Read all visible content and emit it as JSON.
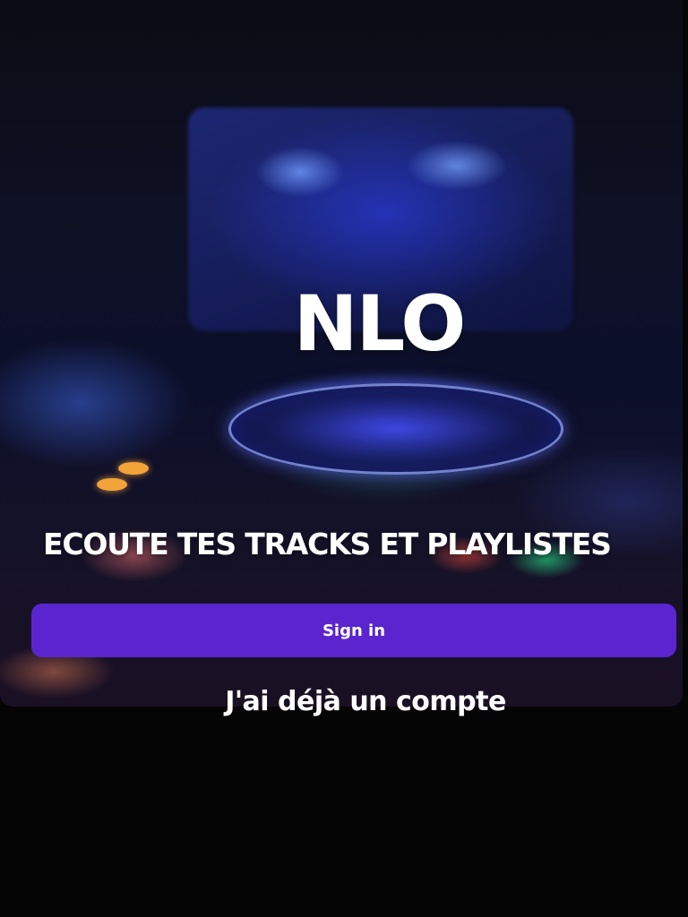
{
  "app": {
    "brand": "NLO",
    "tagline": "ECOUTE TES TRACKS ET PLAYLISTES"
  },
  "actions": {
    "sign_in_label": "Sign in",
    "existing_account_label": "J'ai déjà un compte"
  },
  "colors": {
    "accent": "#5a25cf",
    "background": "#050505",
    "text": "#ffffff"
  },
  "background_image": {
    "subject": "DJ turntable deck with laptop under blue neon light"
  }
}
